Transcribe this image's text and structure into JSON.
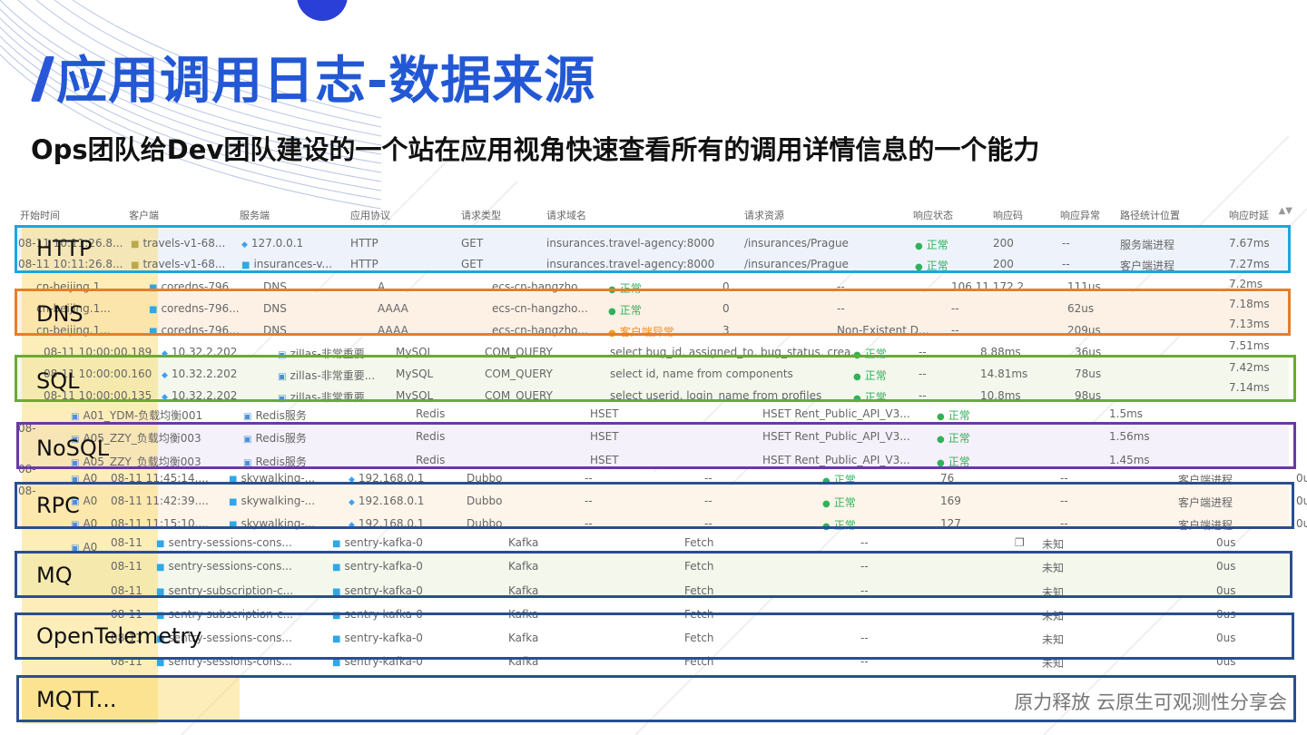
{
  "title": "应用调用日志-数据来源",
  "subtitle": "Ops团队给Dev团队建设的一个站在应用视角快速查看所有的调用详情信息的一个能力",
  "footer": "原力释放 云原生可观测性分享会",
  "colors": {
    "title": "#2358d4",
    "http_box": "#1aa7e0",
    "dns_box": "#e87d27",
    "sql_box": "#6aaa36",
    "nosql_box": "#6a3aa0",
    "rpc_box": "#2a4f8f",
    "mq_box": "#2a4f8f",
    "otel_box": "#2a4f8f",
    "mqtt_box": "#2a4f8f",
    "highlight": "#f6d46a"
  },
  "header": [
    "开始时间",
    "客户端",
    "服务端",
    "应用协议",
    "请求类型",
    "请求域名",
    "请求资源",
    "响应状态",
    "响应码",
    "响应异常",
    "路径统计位置",
    "响应时延"
  ],
  "sort_icon": "sort-icon",
  "labels": {
    "http": "HTTP",
    "dns": "DNS",
    "sql": "SQL",
    "nosql": "NoSQL",
    "rpc": "RPC",
    "mq": "MQ",
    "otel": "OpenTelemetry",
    "mqtt": "MQTT..."
  },
  "http_rows": [
    {
      "time": "08-11 10:11:26.8...",
      "client": "travels-v1-68...",
      "server": "127.0.0.1",
      "proto": "HTTP",
      "type": "GET",
      "domain": "insurances.travel-agency:8000",
      "resource": "/insurances/Prague",
      "status": "正常",
      "code": "200",
      "err": "--",
      "pos": "服务端进程",
      "latency": "7.67ms"
    },
    {
      "time": "08-11 10:11:26.8...",
      "client": "travels-v1-68...",
      "server": "insurances-v...",
      "proto": "HTTP",
      "type": "GET",
      "domain": "insurances.travel-agency:8000",
      "resource": "/insurances/Prague",
      "status": "正常",
      "code": "200",
      "err": "--",
      "pos": "客户端进程",
      "latency": "7.27ms"
    }
  ],
  "dns_rows": [
    {
      "client": "cn-beijing.1",
      "server": "coredns-796...",
      "proto": "DNS",
      "type": "A",
      "domain": "ecs-cn-hangzho...",
      "status": "正常",
      "code": "0",
      "resource": "--",
      "answer": "106.11.172.2",
      "latency": "111us",
      "right": "7.2ms"
    },
    {
      "client": "cn-beijing.1...",
      "server": "coredns-796...",
      "proto": "DNS",
      "type": "AAAA",
      "domain": "ecs-cn-hangzho...",
      "status": "正常",
      "code": "0",
      "resource": "--",
      "answer": "--",
      "latency": "62us",
      "right": "7.18ms"
    },
    {
      "client": "cn-beijing.1...",
      "server": "coredns-796...",
      "proto": "DNS",
      "type": "AAAA",
      "domain": "ecs-cn-hangzho...",
      "status": "客户端异常",
      "code": "3",
      "resource": "Non-Existent D...",
      "answer": "--",
      "latency": "209us",
      "right": "7.13ms"
    }
  ],
  "sql_rows": [
    {
      "time": "08-11 10:00:00.189",
      "client": "10.32.2.202",
      "server": "zillas-非常重要...",
      "proto": "MySQL",
      "type": "COM_QUERY",
      "resource": "select bug_id, assigned_to, bug_status, crea...",
      "status": "正常",
      "err": "--",
      "dur": "8.88ms",
      "latency": "36us",
      "right": "7.51ms"
    },
    {
      "time": "08-11 10:00:00.160",
      "client": "10.32.2.202",
      "server": "zillas-非常重要...",
      "proto": "MySQL",
      "type": "COM_QUERY",
      "resource": "select id, name from components",
      "status": "正常",
      "err": "--",
      "dur": "14.81ms",
      "latency": "78us",
      "right": "7.42ms"
    },
    {
      "time": "08-11 10:00:00.135",
      "client": "10.32.2.202",
      "server": "zillas-非常重要...",
      "proto": "MySQL",
      "type": "COM_QUERY",
      "resource": "select userid, login_name from profiles",
      "status": "正常",
      "err": "--",
      "dur": "10.8ms",
      "latency": "98us",
      "right": "7.14ms"
    }
  ],
  "nosql_rows": [
    {
      "client": "A01_YDM-负载均衡001",
      "server": "Redis服务",
      "proto": "Redis",
      "type": "HSET",
      "resource": "HSET Rent_Public_API_V3...",
      "status": "正常",
      "latency": "1.5ms"
    },
    {
      "client": "A05_ZZY_负载均衡003",
      "server": "Redis服务",
      "proto": "Redis",
      "type": "HSET",
      "resource": "HSET Rent_Public_API_V3...",
      "status": "正常",
      "latency": "1.56ms"
    },
    {
      "client": "A05_ZZY_负载均衡003",
      "server": "Redis服务",
      "proto": "Redis",
      "type": "HSET",
      "resource": "HSET Rent_Public_API_V3...",
      "status": "正常",
      "latency": "1.45ms"
    }
  ],
  "rpc_rows": [
    {
      "time": "08-11 11:45:14....",
      "client": "skywalking-...",
      "server": "192.168.0.1",
      "proto": "Dubbo",
      "type": "--",
      "domain": "--",
      "status": "正常",
      "code": "76",
      "err": "--",
      "pos": "客户端进程",
      "tail": "0u"
    },
    {
      "time": "08-11 11:42:39....",
      "client": "skywalking-...",
      "server": "192.168.0.1",
      "proto": "Dubbo",
      "type": "--",
      "domain": "--",
      "status": "正常",
      "code": "169",
      "err": "--",
      "pos": "客户端进程",
      "tail": "0u"
    },
    {
      "time": "08-11 11:15:10....",
      "client": "skywalking-...",
      "server": "192.168.0.1",
      "proto": "Dubbo",
      "type": "--",
      "domain": "--",
      "status": "正常",
      "code": "127",
      "err": "--",
      "pos": "客户端进程",
      "tail": "0u"
    }
  ],
  "mq_rows": [
    {
      "time": "08-11",
      "client": "sentry-sessions-cons...",
      "server": "sentry-kafka-0",
      "proto": "Kafka",
      "type": "Fetch",
      "code": "--",
      "status": "未知",
      "latency": "0us"
    },
    {
      "time": "08-11",
      "client": "sentry-sessions-cons...",
      "server": "sentry-kafka-0",
      "proto": "Kafka",
      "type": "Fetch",
      "code": "--",
      "status": "未知",
      "latency": "0us"
    },
    {
      "time": "08-11",
      "client": "sentry-subscription-c...",
      "server": "sentry-kafka-0",
      "proto": "Kafka",
      "type": "Fetch",
      "code": "--",
      "status": "未知",
      "latency": "0us"
    },
    {
      "time": "08-11",
      "client": "sentry-subscription-c...",
      "server": "sentry-kafka-0",
      "proto": "Kafka",
      "type": "Fetch",
      "code": "--",
      "status": "未知",
      "latency": "0us"
    },
    {
      "time": "08-11",
      "client": "sentry-sessions-cons...",
      "server": "sentry-kafka-0",
      "proto": "Kafka",
      "type": "Fetch",
      "code": "--",
      "status": "未知",
      "latency": "0us"
    },
    {
      "time": "08-11",
      "client": "sentry-sessions-cons...",
      "server": "sentry-kafka-0",
      "proto": "Kafka",
      "type": "Fetch",
      "code": "--",
      "status": "未知",
      "latency": "0us"
    }
  ],
  "side_tags": [
    "08-",
    "08-",
    "08-"
  ],
  "row_codes": [
    "A0",
    "A0",
    "A0",
    "A0"
  ]
}
